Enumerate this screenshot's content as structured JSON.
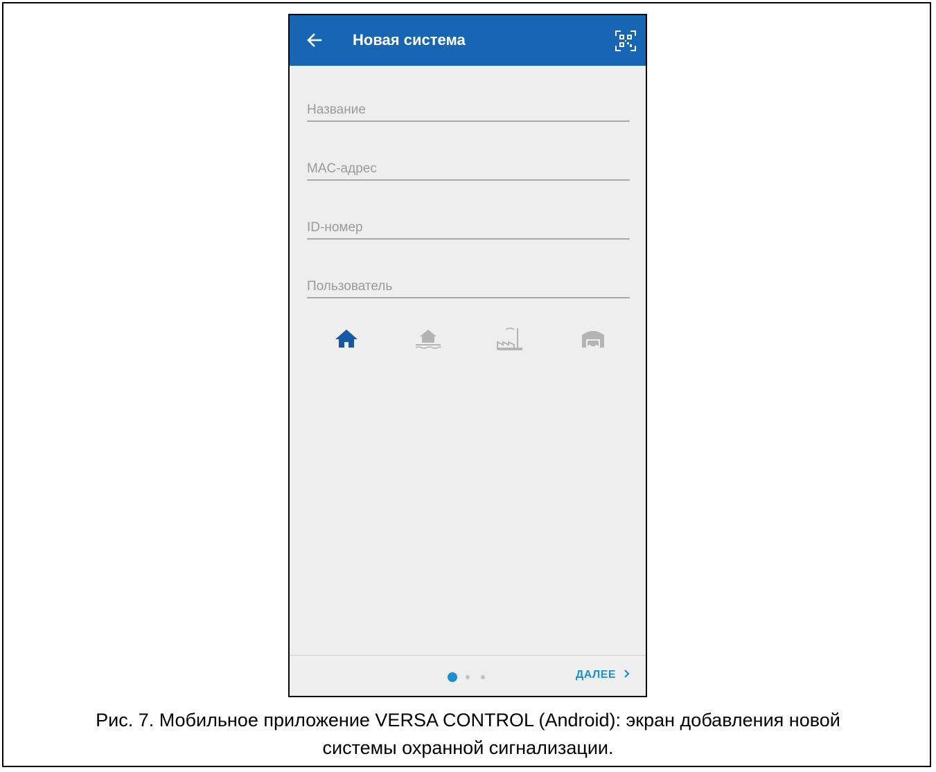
{
  "appbar": {
    "title": "Новая система",
    "back_icon": "arrow-left-icon",
    "qr_icon": "qr-code-scan-icon",
    "color": "#1766b3"
  },
  "form": {
    "fields": [
      {
        "placeholder": "Название",
        "value": ""
      },
      {
        "placeholder": "MAC-адрес",
        "value": ""
      },
      {
        "placeholder": "ID-номер",
        "value": ""
      },
      {
        "placeholder": "Пользователь",
        "value": ""
      }
    ]
  },
  "system_types": {
    "items": [
      {
        "icon": "house-icon",
        "selected": true
      },
      {
        "icon": "lakeside-house-icon",
        "selected": false
      },
      {
        "icon": "factory-icon",
        "selected": false
      },
      {
        "icon": "garage-icon",
        "selected": false
      }
    ],
    "selected_color": "#1559a6",
    "unselected_color": "#b4b4b4"
  },
  "pager": {
    "current_page": 1,
    "total_pages": 3,
    "next_label": "ДАЛЕЕ",
    "next_icon": "chevron-right-icon",
    "accent": "#1b8fd0"
  },
  "caption": {
    "line1": "Рис. 7. Мобильное приложение VERSA CONTROL (Android): экран добавления новой",
    "line2": "системы охранной сигнализации."
  }
}
